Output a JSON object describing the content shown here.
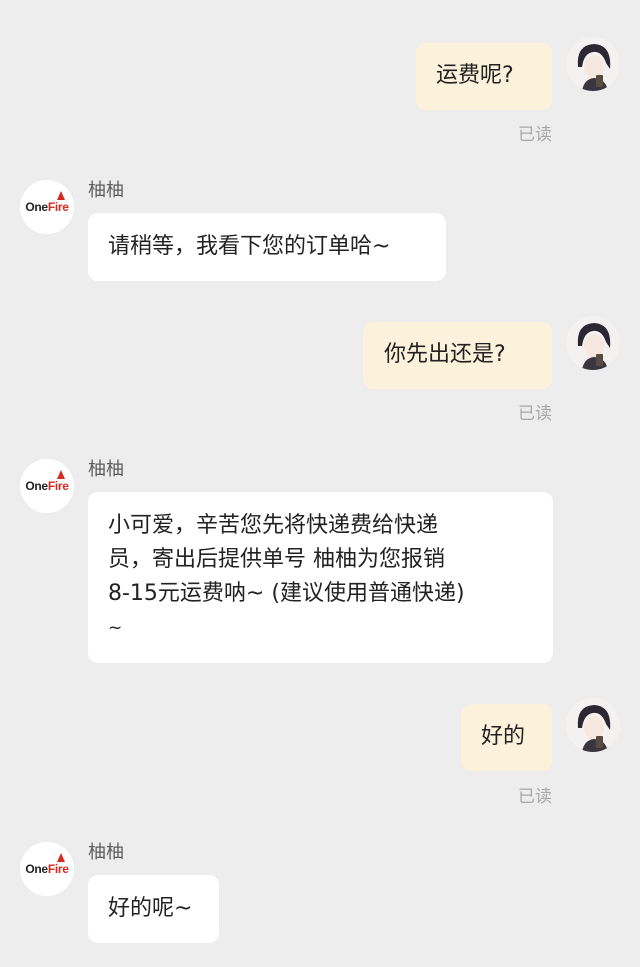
{
  "shop": {
    "name": "柚柚",
    "logo_text_one": "One",
    "logo_text_fire": "Fire",
    "logo_brand_color": "#d42b20"
  },
  "read_label": "已读",
  "colors": {
    "background": "#ededed",
    "outgoing_bubble": "#fcf2dc",
    "incoming_bubble": "#ffffff",
    "read_status": "#a8a8a8"
  },
  "messages": [
    {
      "from": "user",
      "text": "运费呢?",
      "status": "已读"
    },
    {
      "from": "shop",
      "sender": "柚柚",
      "text": "请稍等，我看下您的订单哈~"
    },
    {
      "from": "user",
      "text": "你先出还是?",
      "status": "已读"
    },
    {
      "from": "shop",
      "sender": "柚柚",
      "lines": [
        "小可爱，辛苦您先将快递费给快递",
        "员，寄出后提供单号 柚柚为您报销",
        "8-15元运费呐~ (建议使用普通快递)",
        "~"
      ]
    },
    {
      "from": "user",
      "text": "好的",
      "status": "已读"
    },
    {
      "from": "shop",
      "sender": "柚柚",
      "text": "好的呢~"
    }
  ]
}
